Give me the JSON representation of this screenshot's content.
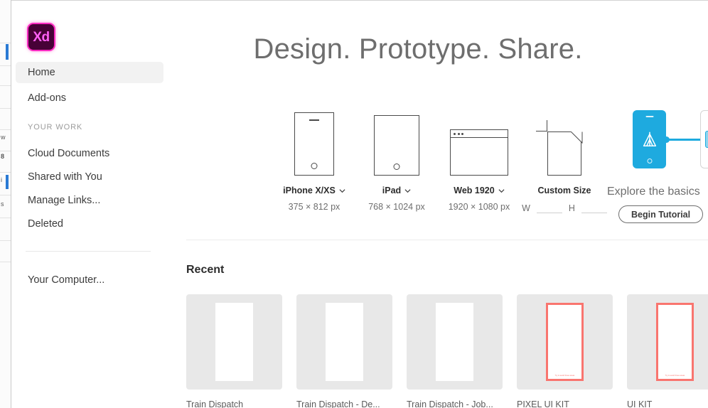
{
  "window": {
    "traffic_light_color": "#ff5f52",
    "app_logo_text": "Xd"
  },
  "sidebar": {
    "items": [
      {
        "label": "Home",
        "active": true
      },
      {
        "label": "Add-ons",
        "active": false
      }
    ],
    "section_title": "YOUR WORK",
    "work_items": [
      {
        "label": "Cloud Documents"
      },
      {
        "label": "Shared with You"
      },
      {
        "label": "Manage Links..."
      },
      {
        "label": "Deleted"
      }
    ],
    "computer_item": {
      "label": "Your Computer..."
    }
  },
  "main": {
    "hero_title": "Design. Prototype. Share.",
    "presets": [
      {
        "art": "phone",
        "name": "iPhone X/XS",
        "has_chevron": true,
        "dimensions": "375 × 812 px"
      },
      {
        "art": "tablet",
        "name": "iPad",
        "has_chevron": true,
        "dimensions": "768 × 1024 px"
      },
      {
        "art": "browser",
        "name": "Web 1920",
        "has_chevron": true,
        "dimensions": "1920 × 1080 px"
      },
      {
        "art": "document",
        "name": "Custom Size",
        "has_chevron": false,
        "width_label": "W",
        "height_label": "H",
        "width_value": "",
        "height_value": ""
      }
    ],
    "tutorial": {
      "caption": "Explore the basics",
      "button_label": "Begin Tutorial",
      "accent_color": "#1eaadf"
    },
    "recent": {
      "title": "Recent",
      "cards": [
        {
          "label": "Train Dispatch",
          "style": "plain",
          "note": ""
        },
        {
          "label": "Train Dispatch - De...",
          "style": "plain",
          "note": ""
        },
        {
          "label": "Train Dispatch - Job...",
          "style": "plain",
          "note": ""
        },
        {
          "label": "PIXEL UI KIT",
          "style": "bordered",
          "note": "Try to avoid these areas"
        },
        {
          "label": "UI KIT",
          "style": "bordered",
          "note": "Try to avoid these areas"
        }
      ]
    }
  }
}
